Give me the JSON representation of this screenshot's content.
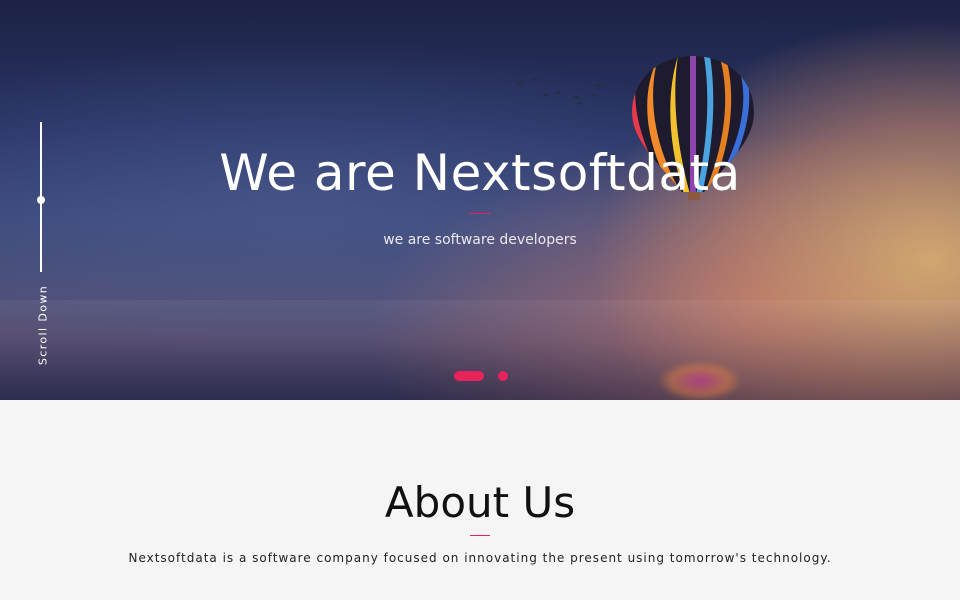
{
  "hero": {
    "title": "We are Nextsoftdata",
    "subtitle": "we are software developers",
    "scroll_label": "Scroll Down",
    "slides": {
      "count": 2,
      "active_index": 0
    }
  },
  "about": {
    "title": "About Us",
    "description": "Nextsoftdata is a software company focused on innovating the present using tomorrow's technology."
  },
  "colors": {
    "accent": "#e8225a",
    "section_background": "#f5f5f5",
    "hero_text": "#ffffff"
  }
}
